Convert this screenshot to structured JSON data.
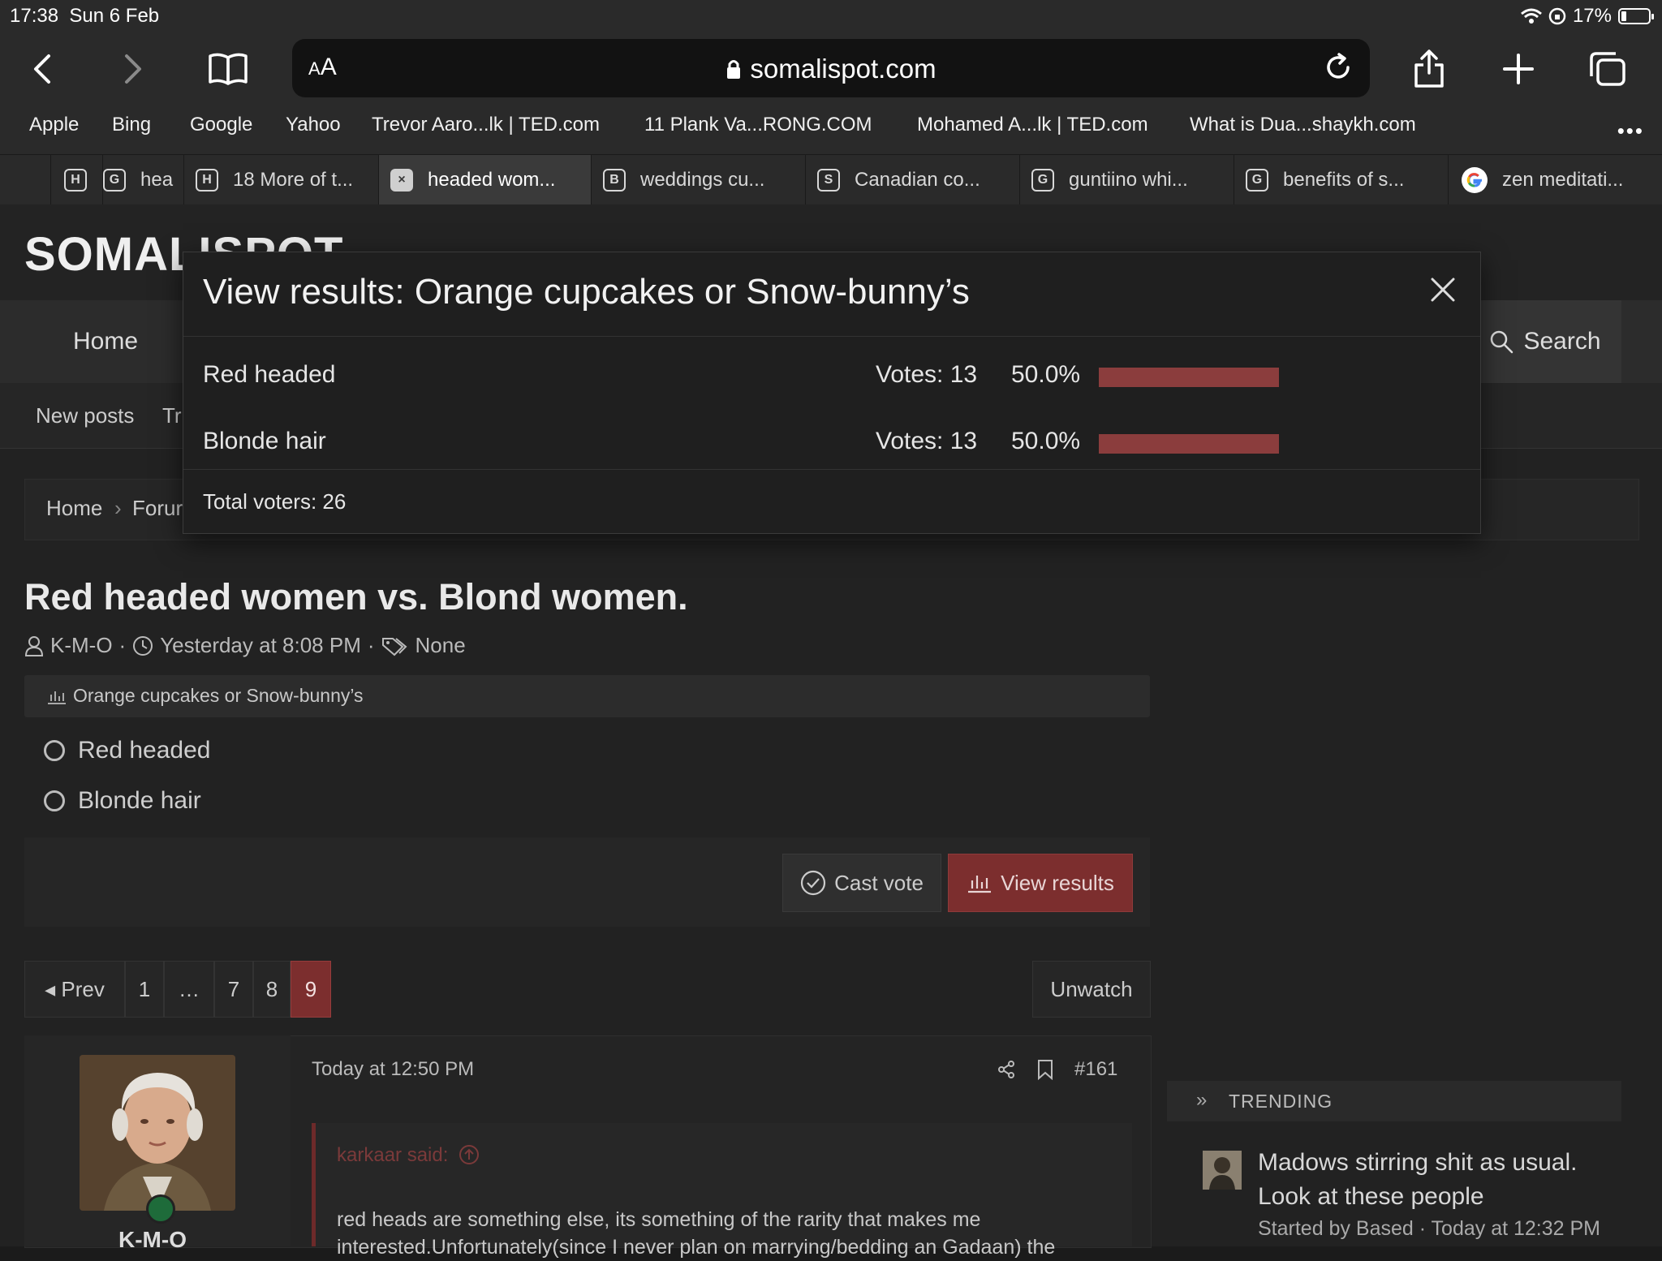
{
  "status": {
    "time": "17:38",
    "date": "Sun 6 Feb",
    "battery": "17%"
  },
  "browser": {
    "aa_small": "A",
    "aa_big": "A",
    "domain": "somalispot.com",
    "favorites": [
      "Apple",
      "Bing",
      "Google",
      "Yahoo",
      "Trevor Aaro...lk | TED.com",
      "11 Plank Va...RONG.COM",
      "Mohamed A...lk | TED.com",
      "What is Dua...shaykh.com"
    ],
    "more": "•••",
    "tabs": [
      {
        "icon": "H",
        "label": ""
      },
      {
        "icon": "G",
        "label": "hea"
      },
      {
        "icon": "H",
        "label": "18 More of t..."
      },
      {
        "icon": "×",
        "label": "headed wom..."
      },
      {
        "icon": "B",
        "label": "weddings cu..."
      },
      {
        "icon": "S",
        "label": "Canadian co..."
      },
      {
        "icon": "G",
        "label": "guntiino whi..."
      },
      {
        "icon": "G",
        "label": "benefits of s..."
      },
      {
        "icon": "G",
        "label": "zen meditati..."
      }
    ]
  },
  "site": {
    "logo": "SOMALISPOT",
    "nav_home": "Home",
    "nav_search": "Search",
    "sub_new_posts": "New posts",
    "sub_tr": "Tr",
    "crumb_home": "Home",
    "crumb_forum": "Forur"
  },
  "thread": {
    "title": "Red headed women vs. Blond women.",
    "author": "K-M-O",
    "date": "Yesterday at 8:08 PM",
    "tags": "None"
  },
  "poll": {
    "question": "Orange cupcakes or Snow-bunny’s",
    "options": [
      "Red headed",
      "Blonde hair"
    ],
    "cast_vote": "Cast vote",
    "view_results": "View results"
  },
  "pagination": {
    "prev": "Prev",
    "pages": [
      "1",
      "…",
      "7",
      "8",
      "9"
    ],
    "current": "9",
    "unwatch": "Unwatch"
  },
  "post": {
    "username": "K-M-O",
    "date": "Today at 12:50 PM",
    "number": "#161",
    "quote_author": "karkaar said:",
    "quote_text": "red heads are something else, its something of the rarity that makes me interested.Unfortunately(since I never plan on marrying/bedding an Gadaan) the"
  },
  "trending": {
    "label": "TRENDING",
    "title": "Madows stirring shit as usual. Look at these people",
    "meta": "Started by Based · Today at 12:32 PM"
  },
  "modal": {
    "title": "View results: Orange cupcakes or Snow-bunny’s",
    "rows": [
      {
        "label": "Red headed",
        "votes": "Votes: 13",
        "pct": "50.0%",
        "fraction": 0.5
      },
      {
        "label": "Blonde hair",
        "votes": "Votes: 13",
        "pct": "50.0%",
        "fraction": 0.5
      }
    ],
    "total": "Total voters: 26"
  },
  "colors": {
    "accent": "#7c2e2e",
    "bar": "#8b3d3d"
  }
}
